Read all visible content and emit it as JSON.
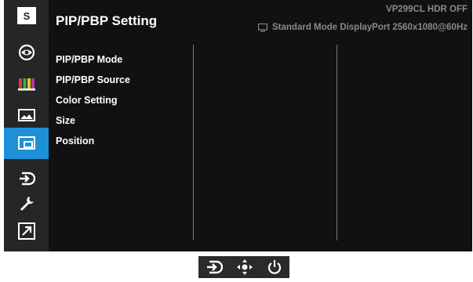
{
  "sidebar": {
    "logo_letter": "S",
    "items": [
      {
        "icon": "splendid-icon"
      },
      {
        "icon": "color-bars-icon"
      },
      {
        "icon": "image-icon"
      },
      {
        "icon": "pip-pbp-icon",
        "active": true
      },
      {
        "icon": "input-select-icon"
      },
      {
        "icon": "wrench-icon"
      },
      {
        "icon": "shortcut-icon"
      }
    ]
  },
  "header": {
    "title": "PIP/PBP Setting",
    "model": "VP299CL   HDR OFF",
    "status": "Standard Mode  DisplayPort  2560x1080@60Hz"
  },
  "menu": {
    "items": [
      "PIP/PBP Mode",
      "PIP/PBP Source",
      "Color Setting",
      "Size",
      "Position"
    ]
  },
  "colors": {
    "active_accent": "#1e90d8",
    "background": "#111111",
    "sidebar": "#262626",
    "header_text": "#8a8a8a"
  },
  "controls": {
    "buttons": [
      "input-select-icon",
      "navigate-icon",
      "power-icon"
    ]
  }
}
